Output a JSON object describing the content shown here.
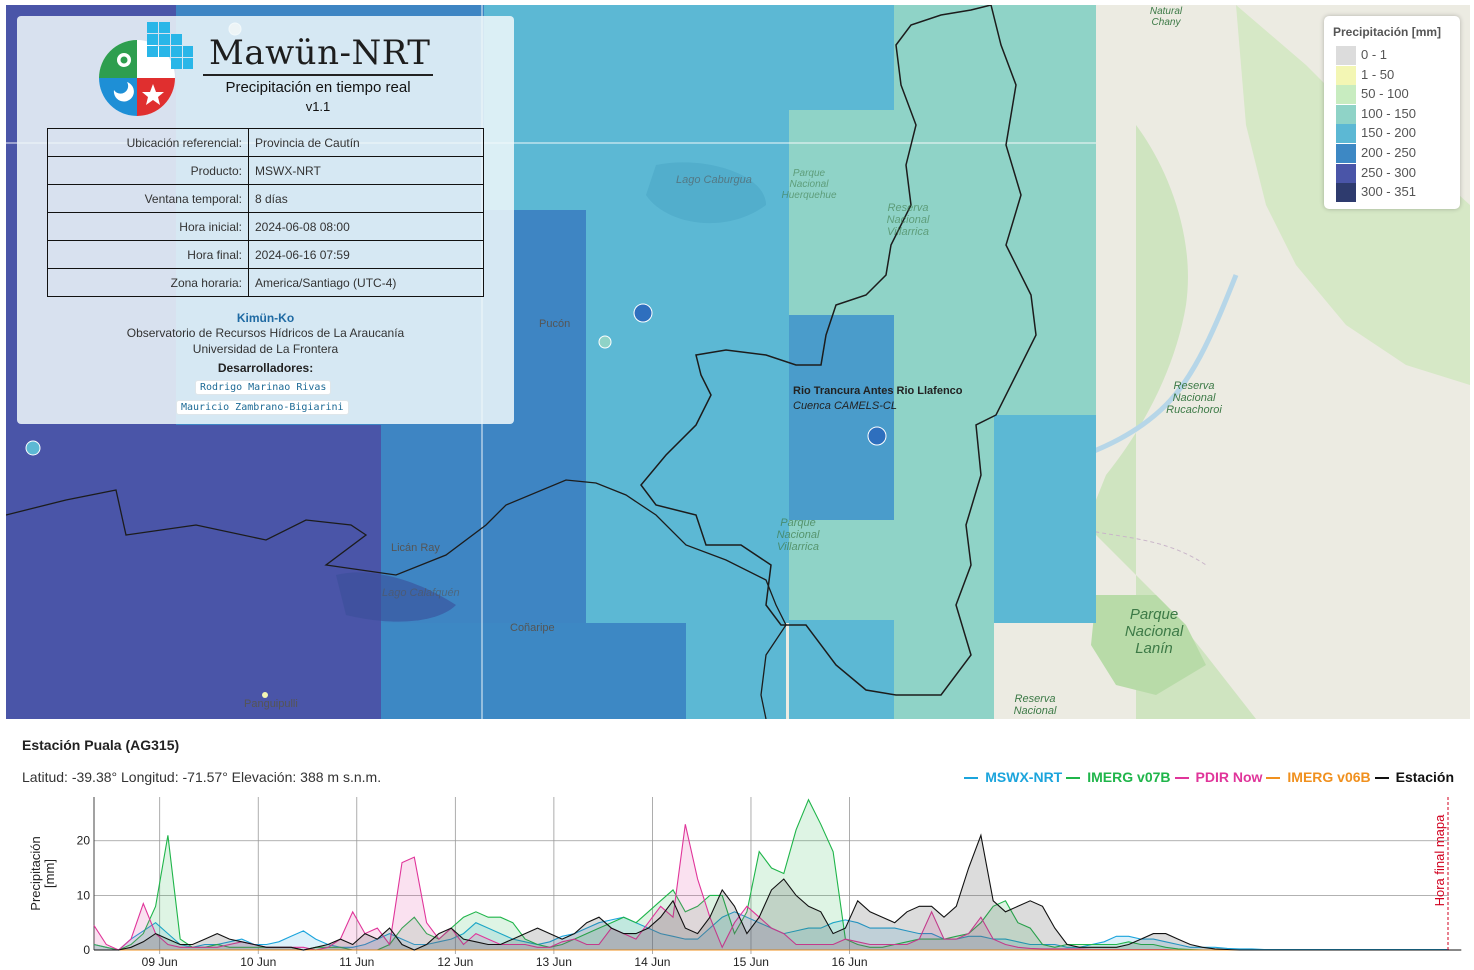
{
  "app": {
    "name": "Mawün-NRT",
    "subtitle": "Precipitación en tiempo real",
    "version": "v1.1"
  },
  "info_table": [
    {
      "key": "Ubicación referencial:",
      "value": "Provincia de Cautín"
    },
    {
      "key": "Producto:",
      "value": "MSWX-NRT"
    },
    {
      "key": "Ventana temporal:",
      "value": "8 días"
    },
    {
      "key": "Hora inicial:",
      "value": "2024-06-08 08:00"
    },
    {
      "key": "Hora final:",
      "value": "2024-06-16 07:59"
    },
    {
      "key": "Zona horaria:",
      "value": "America/Santiago (UTC-4)"
    }
  ],
  "org": {
    "name": "Kimün-Ko",
    "line1": "Observatorio de Recursos Hídricos de La Araucanía",
    "line2": "Universidad de La Frontera",
    "developers_title": "Desarrolladores:",
    "developers": [
      "Rodrigo Marinao Rivas",
      "Mauricio Zambrano-Bigiarini"
    ]
  },
  "legend": {
    "title": "Precipitación [mm]",
    "items": [
      {
        "label": "0 - 1",
        "color": "#dcdcdc"
      },
      {
        "label": "1 - 50",
        "color": "#f3f6b4"
      },
      {
        "label": "50 - 100",
        "color": "#c8ecc0"
      },
      {
        "label": "100 - 150",
        "color": "#8fd3c7"
      },
      {
        "label": "150 - 200",
        "color": "#5cb8d4"
      },
      {
        "label": "200 - 250",
        "color": "#3d88c4"
      },
      {
        "label": "250 - 300",
        "color": "#4a55a8"
      },
      {
        "label": "300 - 351",
        "color": "#2e3b6e"
      }
    ]
  },
  "map": {
    "selected_station": {
      "name": "Rio Trancura Antes Rio Llafenco",
      "source": "Cuenca CAMELS-CL"
    },
    "places": [
      {
        "name": "Pucón"
      },
      {
        "name": "Licán Ray"
      },
      {
        "name": "Lago Calafquén"
      },
      {
        "name": "Coñaripe"
      },
      {
        "name": "Panguipulli"
      },
      {
        "name": "Lago Caburgua"
      },
      {
        "name": "Parque Nacional Huerquehue"
      },
      {
        "name": "Reserva Nacional Villarrica"
      },
      {
        "name": "Parque Nacional Villarrica"
      },
      {
        "name": "Reserva Nacional Rucachoroi"
      },
      {
        "name": "Parque Nacional Lanín"
      },
      {
        "name": "Reserva Nacional"
      },
      {
        "name": "Natural Chany"
      }
    ]
  },
  "station": {
    "title": "Estación Puala (AG315)",
    "coords": "Latitud: -39.38° Longitud: -71.57° Elevación: 388 m s.n.m."
  },
  "chart_data": {
    "type": "area",
    "ylabel": "Precipitación [mm]",
    "annotation": "Hora final mapa",
    "y_ticks": [
      0,
      10,
      20
    ],
    "ylim": [
      0,
      28
    ],
    "x_start": "2024-06-08 08:00",
    "x_step_hours": 3,
    "x_ticks": [
      "09 Jun",
      "10 Jun",
      "11 Jun",
      "12 Jun",
      "13 Jun",
      "14 Jun",
      "15 Jun",
      "16 Jun"
    ],
    "series": [
      {
        "name": "MSWX-NRT",
        "color": "#1ba4dc",
        "values": [
          1,
          0.5,
          0,
          2,
          3.5,
          5,
          3,
          1,
          0.5,
          1,
          1,
          1.5,
          2,
          1,
          1,
          1.5,
          2.5,
          3.5,
          2,
          1,
          0.5,
          0.5,
          1,
          2,
          3,
          2,
          1,
          1,
          1.5,
          2,
          3,
          5,
          4,
          3,
          2,
          1.5,
          1,
          1.5,
          2.5,
          3,
          4,
          5,
          5.5,
          6,
          5,
          4,
          3,
          2.5,
          2,
          2,
          4,
          6,
          7,
          6,
          5,
          4,
          3,
          3.5,
          4,
          4,
          5,
          5.5,
          5,
          4,
          4,
          4,
          3.5,
          3,
          3,
          2,
          2,
          2.5,
          2.5,
          2,
          2,
          1.5,
          1,
          1,
          1,
          0.5,
          0.5,
          1,
          1.5,
          2.5,
          2.5,
          2,
          2,
          1.5,
          1,
          0.5,
          0.5,
          0.5,
          0.3,
          0.2,
          0.2,
          0.1,
          0.1,
          0.1,
          0.1,
          0.1,
          0.1,
          0.1,
          0.1,
          0.1,
          0.1,
          0.1,
          0.1,
          0.1,
          0.1,
          0.1,
          0.1
        ]
      },
      {
        "name": "IMERG v07B",
        "color": "#1fb54a",
        "values": [
          1,
          0.5,
          0,
          1,
          3,
          8,
          21,
          2,
          0.5,
          0.5,
          1,
          0.5,
          0.5,
          0.5,
          0.5,
          0.5,
          0.5,
          0,
          0.5,
          0.5,
          0.5,
          0,
          0,
          0,
          1,
          4,
          6,
          3,
          2,
          4,
          6,
          7,
          6,
          6,
          5,
          2,
          1,
          0.5,
          1,
          2,
          3,
          4,
          5,
          6,
          5,
          7,
          9,
          11,
          7,
          8,
          10,
          10,
          3,
          7,
          18,
          15,
          14,
          22,
          27.5,
          23,
          18,
          2,
          1,
          0.5,
          0.5,
          1,
          1.5,
          2,
          2,
          2,
          2.5,
          3,
          5,
          8,
          9,
          5,
          4,
          1,
          0.5,
          1,
          1,
          1,
          1,
          1,
          1.5,
          1,
          1,
          0.5,
          0.2,
          0.1,
          0,
          0,
          0,
          0,
          0,
          0,
          0,
          0,
          0,
          0,
          0,
          0,
          0,
          0,
          0,
          0,
          0,
          0,
          0
        ]
      },
      {
        "name": "PDIR Now",
        "color": "#e0359a",
        "values": [
          4.5,
          1,
          0,
          2,
          8.5,
          3,
          1,
          0.5,
          0.5,
          0.5,
          0.5,
          1,
          1.5,
          1,
          0.5,
          0.5,
          0.5,
          0.5,
          0,
          0.5,
          2,
          7,
          3,
          4,
          1,
          16,
          17,
          5,
          2,
          4,
          1,
          3,
          2,
          1,
          1,
          1,
          0.5,
          0.5,
          1.5,
          2,
          1,
          1,
          4,
          3,
          2,
          5,
          8,
          6,
          23,
          13,
          6,
          0.5,
          5,
          8,
          6,
          4,
          3,
          1,
          1,
          1,
          1,
          2,
          1.5,
          1,
          1,
          1,
          1,
          2,
          7,
          2,
          2,
          3,
          6,
          2,
          1,
          0.5,
          0.3,
          0.2,
          0.2,
          0.2,
          0.2,
          0.1,
          0.1,
          0.1,
          0.1,
          0.1,
          0.1,
          0.1,
          0,
          0,
          0,
          0,
          0,
          0,
          0,
          0,
          0,
          0,
          0,
          0,
          0,
          0,
          0,
          0,
          0,
          0,
          0
        ]
      },
      {
        "name": "IMERG v06B",
        "color": "#f0901e",
        "values": [
          0,
          0,
          0,
          0,
          0,
          0,
          0,
          0,
          0,
          0,
          0,
          0,
          0,
          0,
          0,
          0,
          0,
          0,
          0,
          0,
          0,
          0,
          0,
          0,
          0,
          0,
          0,
          0,
          0,
          0,
          0,
          0,
          0,
          0,
          0,
          0,
          0,
          0,
          0,
          0,
          0,
          0,
          0,
          0,
          0,
          0,
          0,
          0,
          0,
          0,
          0,
          0,
          0,
          0,
          0,
          0,
          0,
          0,
          0,
          0,
          0,
          0,
          0,
          0,
          0,
          0,
          0,
          0,
          0,
          0,
          0,
          0,
          0,
          0,
          0,
          0,
          0,
          0,
          0,
          0,
          0,
          0,
          0,
          0,
          0,
          0,
          0,
          0,
          0,
          0,
          0,
          0,
          0,
          0,
          0,
          0,
          0,
          0,
          0,
          0,
          0,
          0,
          0,
          0,
          0,
          0,
          0,
          0,
          0
        ]
      },
      {
        "name": "Estación",
        "color": "#111111",
        "values": [
          0,
          0,
          0,
          0.5,
          1.5,
          3,
          2,
          1,
          1,
          2,
          3,
          2,
          1.5,
          1,
          0.5,
          0.5,
          0.5,
          0,
          0.5,
          1,
          2,
          1,
          3,
          2,
          4,
          1,
          0,
          1,
          3,
          4,
          2,
          1.5,
          1,
          1,
          2,
          3,
          4,
          3,
          2,
          3,
          5,
          6,
          4,
          3,
          3,
          4,
          6,
          9,
          4,
          3,
          6,
          11,
          8,
          3,
          6,
          11,
          13,
          10,
          8,
          7,
          3,
          4,
          9,
          7,
          6,
          5,
          7,
          8,
          8,
          6,
          8,
          15,
          21,
          9,
          7,
          8,
          9,
          8,
          4,
          1,
          0.5,
          0.5,
          0.5,
          0.5,
          1,
          2,
          3,
          3,
          2,
          1,
          0.5,
          0.2,
          0.1,
          0,
          0,
          0,
          0,
          0,
          0,
          0,
          0,
          0,
          0,
          0,
          0,
          0,
          0,
          0,
          0,
          0,
          0,
          0
        ]
      }
    ]
  }
}
